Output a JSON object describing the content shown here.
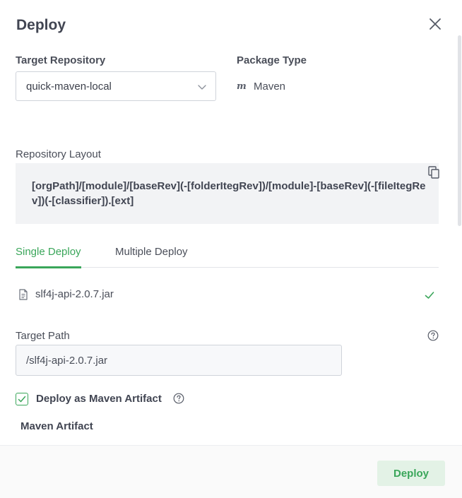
{
  "dialog": {
    "title": "Deploy",
    "close_icon": "close-icon"
  },
  "target_repository": {
    "label": "Target Repository",
    "value": "quick-maven-local",
    "icon": "chevron-down-icon"
  },
  "package_type": {
    "label": "Package Type",
    "icon_glyph": "m",
    "value": "Maven"
  },
  "repository_layout": {
    "label": "Repository Layout",
    "value": "[orgPath]/[module]/[baseRev](-[folderItegRev])/[module]-[baseRev](-[fileItegRev])(-[classifier]).[ext]",
    "copy_icon": "copy-icon"
  },
  "tabs": [
    {
      "label": "Single Deploy",
      "active": true
    },
    {
      "label": "Multiple Deploy",
      "active": false
    }
  ],
  "file": {
    "name": "slf4j-api-2.0.7.jar",
    "icon": "file-icon",
    "status_icon": "check-icon"
  },
  "target_path": {
    "label": "Target Path",
    "value": "/slf4j-api-2.0.7.jar",
    "help_icon": "help-icon"
  },
  "maven_option": {
    "label": "Deploy as Maven Artifact",
    "checked": true,
    "help_icon": "help-icon"
  },
  "maven_section": {
    "heading": "Maven Artifact"
  },
  "footer": {
    "deploy_label": "Deploy"
  },
  "colors": {
    "accent": "#3aa65a",
    "accent_light": "#e3f2e6",
    "text": "#414552",
    "border": "#cfd3da",
    "layout_bg": "#f2f3f5"
  }
}
